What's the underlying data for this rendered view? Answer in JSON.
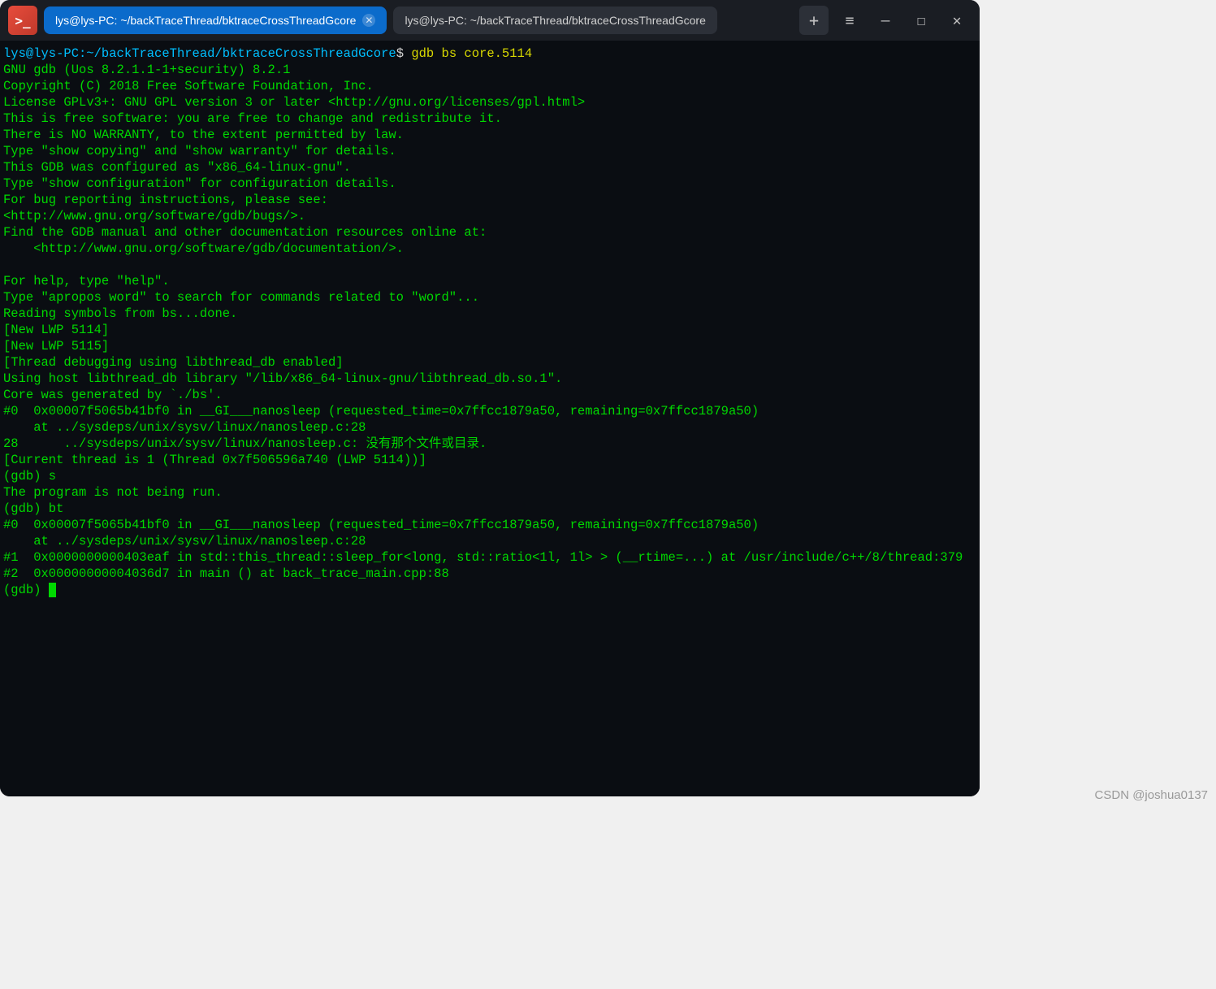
{
  "titlebar": {
    "tabs": [
      {
        "label": "lys@lys-PC: ~/backTraceThread/bktraceCrossThreadGcore",
        "active": true
      },
      {
        "label": "lys@lys-PC: ~/backTraceThread/bktraceCrossThreadGcore",
        "active": false
      }
    ],
    "plus": "+",
    "menu": "≡",
    "minimize": "—",
    "maximize": "☐",
    "close": "✕"
  },
  "prompt": {
    "user": "lys@lys-PC",
    "sep": ":",
    "path": "~/backTraceThread/bktraceCrossThreadGcore",
    "dollar": "$",
    "command": " gdb bs core.5114"
  },
  "lines": {
    "l01": "GNU gdb (Uos 8.2.1.1-1+security) 8.2.1",
    "l02": "Copyright (C) 2018 Free Software Foundation, Inc.",
    "l03": "License GPLv3+: GNU GPL version 3 or later <http://gnu.org/licenses/gpl.html>",
    "l04": "This is free software: you are free to change and redistribute it.",
    "l05": "There is NO WARRANTY, to the extent permitted by law.",
    "l06": "Type \"show copying\" and \"show warranty\" for details.",
    "l07": "This GDB was configured as \"x86_64-linux-gnu\".",
    "l08": "Type \"show configuration\" for configuration details.",
    "l09": "For bug reporting instructions, please see:",
    "l10": "<http://www.gnu.org/software/gdb/bugs/>.",
    "l11": "Find the GDB manual and other documentation resources online at:",
    "l12": "    <http://www.gnu.org/software/gdb/documentation/>.",
    "l13": "",
    "l14": "For help, type \"help\".",
    "l15": "Type \"apropos word\" to search for commands related to \"word\"...",
    "l16": "Reading symbols from bs...done.",
    "l17": "[New LWP 5114]",
    "l18": "[New LWP 5115]",
    "l19": "[Thread debugging using libthread_db enabled]",
    "l20": "Using host libthread_db library \"/lib/x86_64-linux-gnu/libthread_db.so.1\".",
    "l21": "Core was generated by `./bs'.",
    "l22": "#0  0x00007f5065b41bf0 in __GI___nanosleep (requested_time=0x7ffcc1879a50, remaining=0x7ffcc1879a50)",
    "l23": "    at ../sysdeps/unix/sysv/linux/nanosleep.c:28",
    "l24": "28      ../sysdeps/unix/sysv/linux/nanosleep.c: 没有那个文件或目录.",
    "l25": "[Current thread is 1 (Thread 0x7f506596a740 (LWP 5114))]",
    "l26": "(gdb) s",
    "l27": "The program is not being run.",
    "l28": "(gdb) bt",
    "l29": "#0  0x00007f5065b41bf0 in __GI___nanosleep (requested_time=0x7ffcc1879a50, remaining=0x7ffcc1879a50)",
    "l30": "    at ../sysdeps/unix/sysv/linux/nanosleep.c:28",
    "l31": "#1  0x0000000000403eaf in std::this_thread::sleep_for<long, std::ratio<1l, 1l> > (__rtime=...) at /usr/include/c++/8/thread:379",
    "l32": "#2  0x00000000004036d7 in main () at back_trace_main.cpp:88",
    "l33": "(gdb) "
  },
  "watermark": "CSDN @joshua0137"
}
